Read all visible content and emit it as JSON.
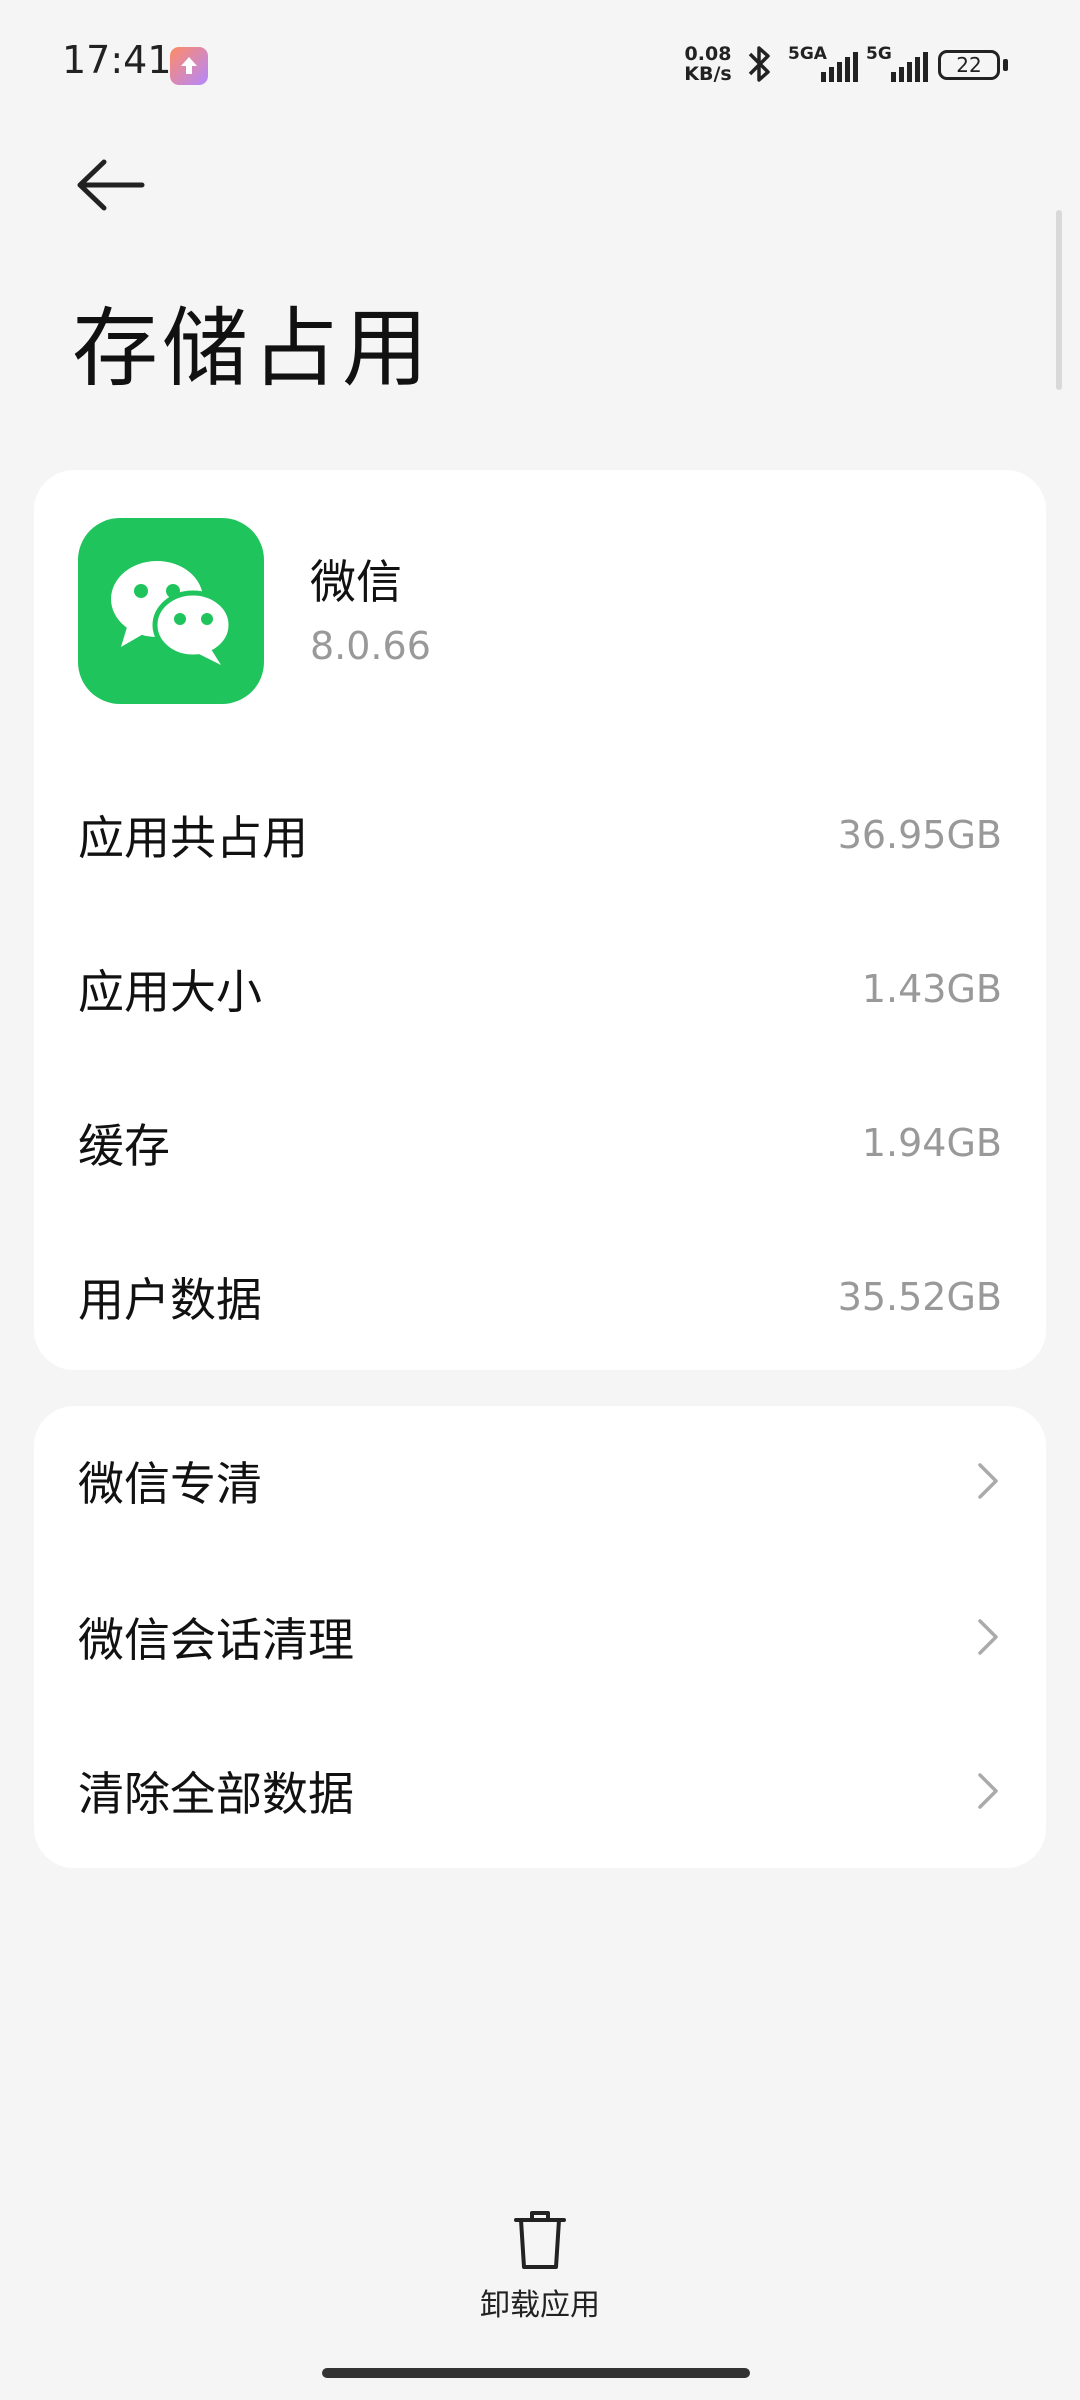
{
  "status_bar": {
    "time": "17:41",
    "net_speed_value": "0.08",
    "net_speed_unit": "KB/s",
    "sim1_label": "5GA",
    "sim2_label": "5G",
    "battery": "22"
  },
  "header": {
    "title": "存储占用"
  },
  "app": {
    "name": "微信",
    "version": "8.0.66",
    "icon": "wechat-icon",
    "icon_color": "#1fc55c"
  },
  "storage": [
    {
      "label": "应用共占用",
      "value": "36.95GB"
    },
    {
      "label": "应用大小",
      "value": "1.43GB"
    },
    {
      "label": "缓存",
      "value": "1.94GB"
    },
    {
      "label": "用户数据",
      "value": "35.52GB"
    }
  ],
  "actions": [
    {
      "label": "微信专清"
    },
    {
      "label": "微信会话清理"
    },
    {
      "label": "清除全部数据"
    }
  ],
  "bottom": {
    "uninstall_label": "卸载应用"
  }
}
